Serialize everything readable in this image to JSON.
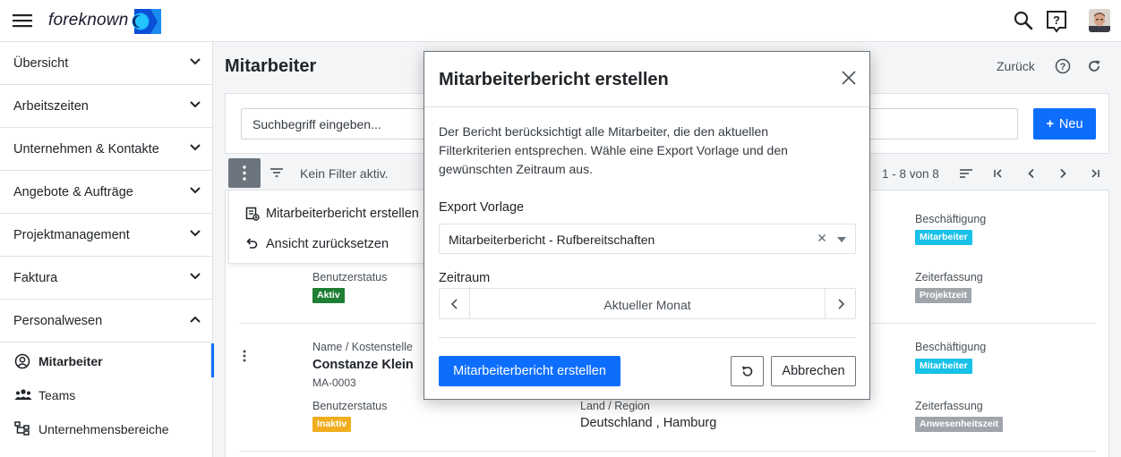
{
  "header": {
    "logo_text": "foreknown",
    "icons": [
      "menu-icon",
      "search-icon",
      "help-icon",
      "avatar"
    ]
  },
  "sidebar": {
    "items": [
      {
        "label": "Übersicht"
      },
      {
        "label": "Arbeitszeiten"
      },
      {
        "label": "Unternehmen & Kontakte"
      },
      {
        "label": "Angebote & Aufträge"
      },
      {
        "label": "Projektmanagement"
      },
      {
        "label": "Faktura"
      },
      {
        "label": "Personalwesen"
      }
    ],
    "sub_items": [
      {
        "label": "Mitarbeiter",
        "icon": "user-circle-icon",
        "active": true
      },
      {
        "label": "Teams",
        "icon": "group-icon"
      },
      {
        "label": "Unternehmensbereiche",
        "icon": "org-chart-icon"
      }
    ]
  },
  "main": {
    "title": "Mitarbeiter",
    "back_label": "Zurück",
    "search_placeholder": "Suchbegriff eingeben...",
    "new_button": "Neu",
    "filter_text": "Kein Filter aktiv.",
    "pager_text": "1 - 8 von 8"
  },
  "dropdown": {
    "items": [
      {
        "label": "Mitarbeiterbericht erstellen",
        "icon": "report-icon"
      },
      {
        "label": "Ansicht zurücksetzen",
        "icon": "undo-icon"
      }
    ]
  },
  "rows": [
    {
      "benutzerstatus_label": "Benutzerstatus",
      "benutzerstatus": "Aktiv",
      "beschaeftigung_label": "Beschäftigung",
      "beschaeftigung": "Mitarbeiter",
      "zeiterfassung_label": "Zeiterfassung",
      "zeiterfassung": "Projektzeit"
    },
    {
      "name_label": "Name / Kostenstelle",
      "name": "Constanze Klein",
      "id": "MA-0003",
      "benutzerstatus_label": "Benutzerstatus",
      "benutzerstatus": "Inaktiv",
      "land_label": "Land / Region",
      "land": "Deutschland , Hamburg",
      "beschaeftigung_label": "Beschäftigung",
      "beschaeftigung": "Mitarbeiter",
      "zeiterfassung_label": "Zeiterfassung",
      "zeiterfassung": "Anwesenheitszeit"
    }
  ],
  "modal": {
    "title": "Mitarbeiterbericht erstellen",
    "description": "Der Bericht berücksichtigt alle Mitarbeiter, die den aktuellen Filterkriterien entsprechen. Wähle eine Export Vorlage und den gewünschten Zeitraum aus.",
    "export_label": "Export Vorlage",
    "export_value": "Mitarbeiterbericht - Rufbereitschaften",
    "zeitraum_label": "Zeitraum",
    "zeitraum_value": "Aktueller Monat",
    "submit_label": "Mitarbeiterbericht erstellen",
    "cancel_label": "Abbrechen"
  },
  "colors": {
    "primary": "#0d6efd",
    "badge_active": "#1e7e34",
    "badge_inactive": "#f0ad1e",
    "badge_employee": "#17c1e8",
    "badge_time": "#a0a5ab"
  }
}
